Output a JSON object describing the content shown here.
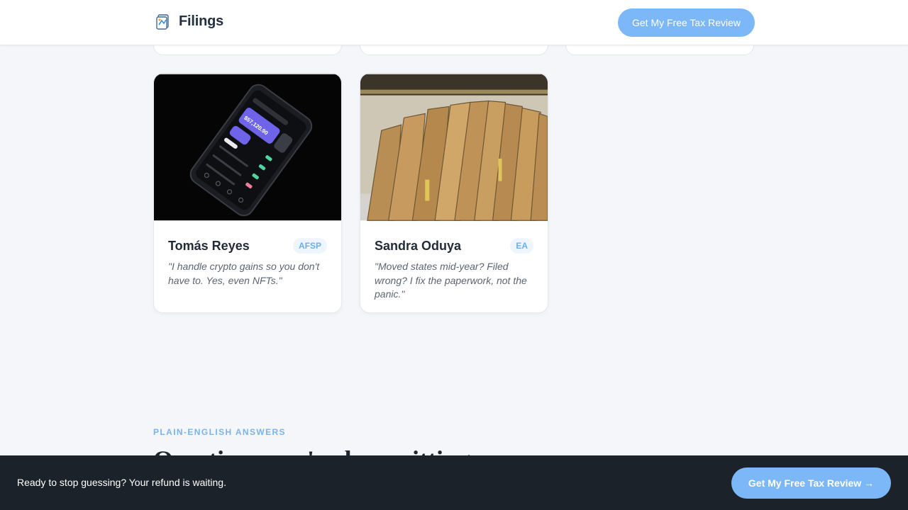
{
  "header": {
    "brand_name": "Filings",
    "cta_label": "Get My Free Tax Review"
  },
  "cards": [
    {
      "name": "Tomás Reyes",
      "badge": "AFSP",
      "quote": "\"I handle crypto gains so you don't have to. Yes, even NFTs.\"",
      "image": "phone-crypto-app-photo",
      "phone_balance": "$57,120.90"
    },
    {
      "name": "Sandra Oduya",
      "badge": "EA",
      "quote": "\"Moved states mid-year? Filed wrong? I fix the paperwork, not the panic.\"",
      "image": "file-folders-photo"
    }
  ],
  "section": {
    "eyebrow": "PLAIN-ENGLISH ANSWERS",
    "title": "Questions you've been sitting on"
  },
  "sticky_bar": {
    "text": "Ready to stop guessing? Your refund is waiting.",
    "cta_label": "Get My Free Tax Review →"
  },
  "colors": {
    "accent": "#7cb8f7",
    "page_background": "#f4f6fa",
    "sticky_background": "#1c2229"
  }
}
